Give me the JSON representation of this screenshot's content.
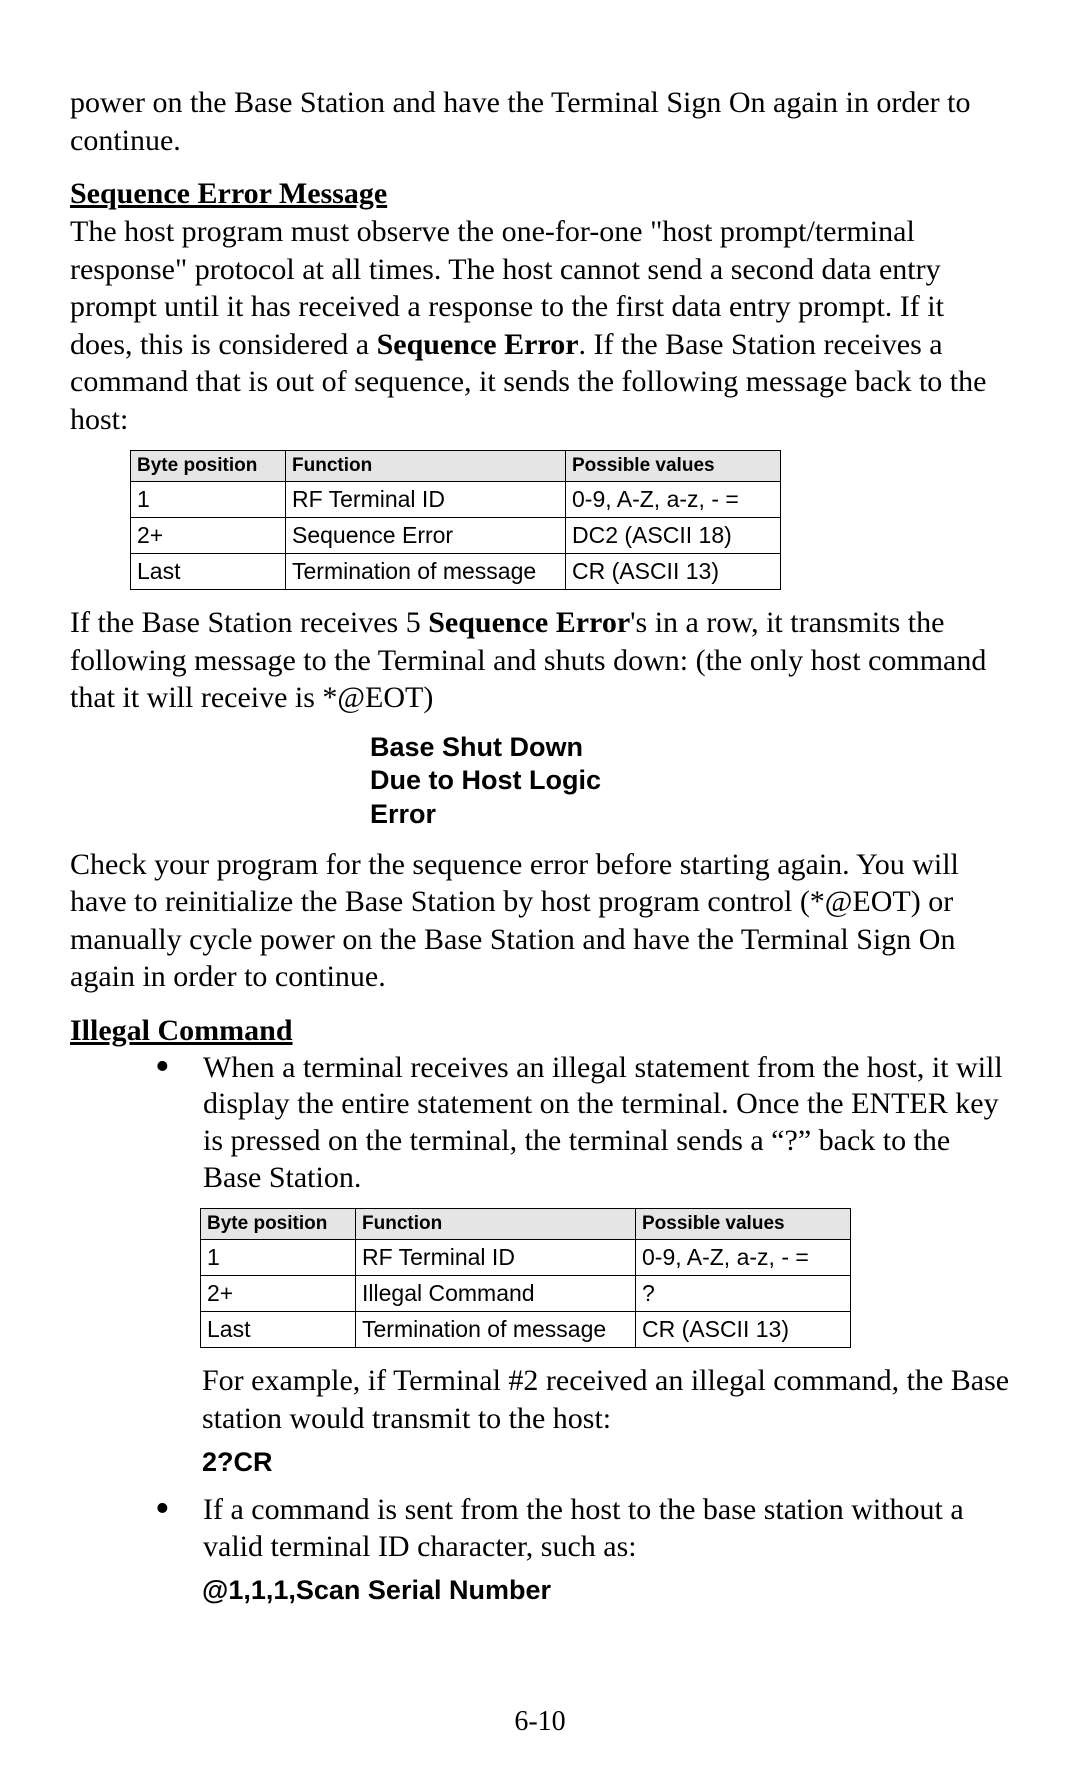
{
  "intro_paragraph": "power on the Base Station and have the Terminal Sign On again in order to continue.",
  "section1": {
    "title": "Sequence Error Message",
    "para1_pre": "The host program must observe the one-for-one \"host prompt/terminal response\" protocol at all times. The host cannot send a second data entry prompt until it has received a response to the first data entry prompt. If it does, this is considered a ",
    "para1_bold": "Sequence Error",
    "para1_post": ". If the Base Station receives a command that is out of sequence, it sends the following message back to the host:",
    "table": {
      "headers": [
        "Byte position",
        "Function",
        "Possible values"
      ],
      "rows": [
        [
          "1",
          "RF Terminal ID",
          "0-9, A-Z, a-z, - ="
        ],
        [
          "2+",
          "Sequence Error",
          "DC2 (ASCII 18)"
        ],
        [
          "Last",
          "Termination of message",
          "CR (ASCII 13)"
        ]
      ]
    },
    "para2_pre": "If the Base Station receives 5 ",
    "para2_bold": "Sequence Error",
    "para2_post": "'s in a row, it transmits the following message to the Terminal and shuts down: (the only host command that it will receive is *@EOT)",
    "message_lines": [
      "Base Shut Down",
      "Due to Host Logic",
      "Error"
    ],
    "para3": "Check your program for the sequence error before starting again. You will have to reinitialize the Base Station by host program control (*@EOT) or manually cycle power on the Base Station and have the Terminal Sign On again in order to continue."
  },
  "section2": {
    "title": "Illegal Command",
    "bullet1": "When a terminal receives an illegal statement from the host, it will display the entire statement on the terminal. Once the ENTER key is pressed on the terminal, the terminal sends a “?” back to the Base Station.",
    "table": {
      "headers": [
        "Byte position",
        "Function",
        "Possible values"
      ],
      "rows": [
        [
          "1",
          "RF Terminal ID",
          "0-9, A-Z, a-z, - ="
        ],
        [
          "2+",
          "Illegal Command",
          "?"
        ],
        [
          "Last",
          "Termination of message",
          "CR (ASCII 13)"
        ]
      ]
    },
    "example_para": "For example, if Terminal #2 received an illegal command, the Base station would transmit to the host:",
    "example_code": "2?CR",
    "bullet2": "If a command is sent from the host to the base station without a valid terminal ID character, such as:",
    "example_code2": "@1,1,1,Scan Serial Number"
  },
  "page_number": "6-10"
}
